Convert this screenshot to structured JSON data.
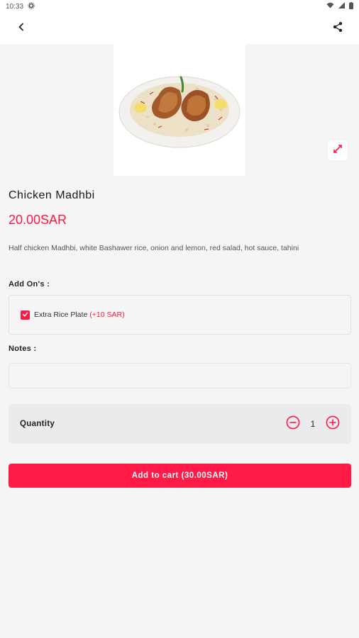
{
  "status_bar": {
    "time": "10:33"
  },
  "product": {
    "name": "Chicken Madhbi",
    "price": "20.00SAR",
    "description": "Half chicken Madhbi, white Bashawer rice, onion and lemon, red salad, hot sauce, tahini"
  },
  "addons": {
    "label": "Add On's :",
    "items": [
      {
        "name": "Extra Rice Plate",
        "price": "(+10 SAR)",
        "checked": true
      }
    ]
  },
  "notes": {
    "label": "Notes :",
    "value": "",
    "placeholder": ""
  },
  "quantity": {
    "label": "Quantity",
    "value": "1"
  },
  "cart_button": {
    "label": "Add to cart (30.00SAR)"
  },
  "colors": {
    "accent": "#ff1744",
    "background": "#f5f5f5"
  },
  "icons": [
    "back-arrow-icon",
    "share-icon",
    "expand-icon",
    "settings-icon",
    "wifi-icon",
    "battery-icon",
    "minus-circle-icon",
    "plus-circle-icon",
    "checkmark-icon"
  ]
}
